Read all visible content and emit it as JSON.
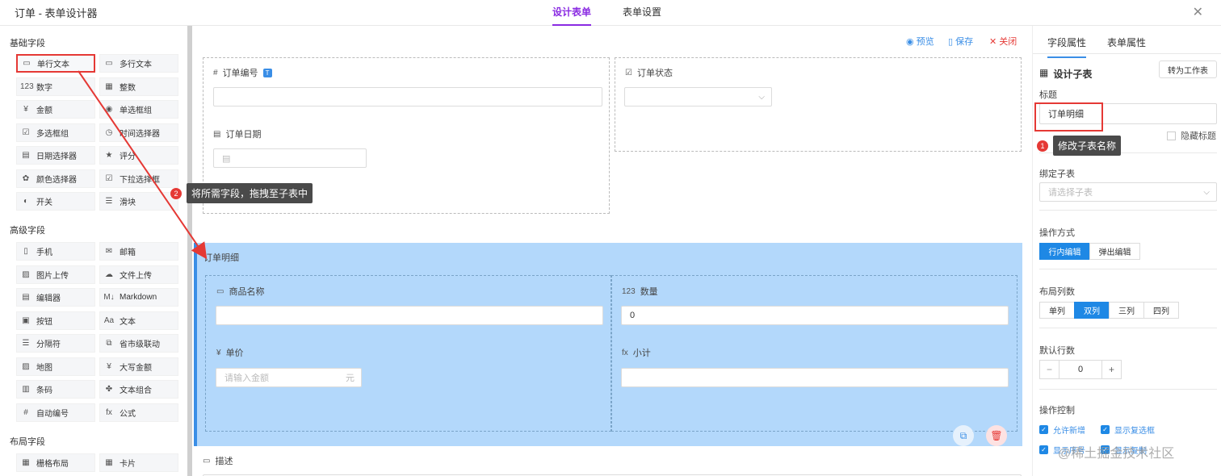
{
  "header": {
    "title": "订单 - 表单设计器",
    "tabs": [
      {
        "label": "设计表单",
        "active": true
      },
      {
        "label": "表单设置",
        "active": false
      }
    ],
    "close_icon": "close-icon"
  },
  "left_panel": {
    "groups": [
      {
        "title": "基础字段",
        "items": [
          {
            "label": "单行文本",
            "icon": "single-line-text-icon",
            "glyph": "▭"
          },
          {
            "label": "多行文本",
            "icon": "multi-line-text-icon",
            "glyph": "▭"
          },
          {
            "label": "数字",
            "icon": "number-icon",
            "glyph": "123"
          },
          {
            "label": "整数",
            "icon": "integer-icon",
            "glyph": "▦"
          },
          {
            "label": "金额",
            "icon": "money-icon",
            "glyph": "¥"
          },
          {
            "label": "单选框组",
            "icon": "radio-icon",
            "glyph": "◉"
          },
          {
            "label": "多选框组",
            "icon": "checkbox-icon",
            "glyph": "☑"
          },
          {
            "label": "时间选择器",
            "icon": "clock-icon",
            "glyph": "◷"
          },
          {
            "label": "日期选择器",
            "icon": "calendar-icon",
            "glyph": "▤"
          },
          {
            "label": "评分",
            "icon": "star-icon",
            "glyph": "★"
          },
          {
            "label": "颜色选择器",
            "icon": "palette-icon",
            "glyph": "✿"
          },
          {
            "label": "下拉选择框",
            "icon": "dropdown-icon",
            "glyph": "☑"
          },
          {
            "label": "开关",
            "icon": "switch-icon",
            "glyph": "◐"
          },
          {
            "label": "滑块",
            "icon": "slider-icon",
            "glyph": "☰"
          }
        ]
      },
      {
        "title": "高级字段",
        "items": [
          {
            "label": "手机",
            "icon": "phone-icon",
            "glyph": "▯"
          },
          {
            "label": "邮箱",
            "icon": "mail-icon",
            "glyph": "✉"
          },
          {
            "label": "图片上传",
            "icon": "image-icon",
            "glyph": "▨"
          },
          {
            "label": "文件上传",
            "icon": "upload-icon",
            "glyph": "☁"
          },
          {
            "label": "编辑器",
            "icon": "editor-icon",
            "glyph": "▤"
          },
          {
            "label": "Markdown",
            "icon": "markdown-icon",
            "glyph": "M↓"
          },
          {
            "label": "按钮",
            "icon": "button-icon",
            "glyph": "▣"
          },
          {
            "label": "文本",
            "icon": "text-icon",
            "glyph": "Aa"
          },
          {
            "label": "分隔符",
            "icon": "divider-icon",
            "glyph": "☰"
          },
          {
            "label": "省市级联动",
            "icon": "cascade-icon",
            "glyph": "⧉"
          },
          {
            "label": "地图",
            "icon": "map-icon",
            "glyph": "▨"
          },
          {
            "label": "大写金额",
            "icon": "uppercase-money-icon",
            "glyph": "¥"
          },
          {
            "label": "条码",
            "icon": "barcode-icon",
            "glyph": "▥"
          },
          {
            "label": "文本组合",
            "icon": "text-combo-icon",
            "glyph": "✤"
          },
          {
            "label": "自动编号",
            "icon": "auto-number-icon",
            "glyph": "#"
          },
          {
            "label": "公式",
            "icon": "formula-icon",
            "glyph": "fx"
          }
        ]
      },
      {
        "title": "布局字段",
        "items": [
          {
            "label": "栅格布局",
            "icon": "grid-layout-icon",
            "glyph": "▦"
          },
          {
            "label": "卡片",
            "icon": "card-icon",
            "glyph": "▦"
          }
        ]
      }
    ]
  },
  "toolbar": {
    "preview": "预览",
    "save": "保存",
    "close": "关闭"
  },
  "form": {
    "order_no": {
      "label": "订单编号",
      "badge": "T"
    },
    "order_status": {
      "label": "订单状态"
    },
    "order_date": {
      "label": "订单日期"
    },
    "subtable": {
      "title": "订单明细",
      "product_name": {
        "label": "商品名称"
      },
      "quantity": {
        "label": "数量",
        "value": "0"
      },
      "unit_price": {
        "label": "单价",
        "placeholder": "请输入金额",
        "unit": "元"
      },
      "subtotal": {
        "label": "小计"
      }
    },
    "description": {
      "label": "描述"
    }
  },
  "right_panel": {
    "tabs": [
      {
        "label": "字段属性",
        "active": true
      },
      {
        "label": "表单属性",
        "active": false
      }
    ],
    "section_title": "设计子表",
    "convert_button": "转为工作表",
    "title_label": "标题",
    "title_value": "订单明细",
    "hide_title": "隐藏标题",
    "bind_label": "绑定子表",
    "bind_placeholder": "请选择子表",
    "op_mode_label": "操作方式",
    "op_modes": [
      {
        "label": "行内编辑",
        "active": true
      },
      {
        "label": "弹出编辑",
        "active": false
      }
    ],
    "layout_label": "布局列数",
    "layout_options": [
      {
        "label": "单列",
        "active": false
      },
      {
        "label": "双列",
        "active": true
      },
      {
        "label": "三列",
        "active": false
      },
      {
        "label": "四列",
        "active": false
      }
    ],
    "default_rows_label": "默认行数",
    "default_rows_value": "0",
    "minus": "−",
    "plus": "+",
    "op_control_label": "操作控制",
    "controls": [
      {
        "label": "允许新增",
        "checked": true
      },
      {
        "label": "显示复选框",
        "checked": true
      },
      {
        "label": "显示序号",
        "checked": true
      },
      {
        "label": "显示复制",
        "checked": true
      }
    ]
  },
  "annotations": {
    "step1": {
      "number": "1",
      "text": "修改子表名称"
    },
    "step2": {
      "number": "2",
      "text": "将所需字段，拖拽至子表中"
    },
    "watermark": "@稀土掘金技术社区"
  },
  "colors": {
    "accent": "#3a8ee6",
    "tab_active": "#8a2be2",
    "subtable_bg": "#b3d8fb",
    "annotation_red": "#e53935"
  }
}
